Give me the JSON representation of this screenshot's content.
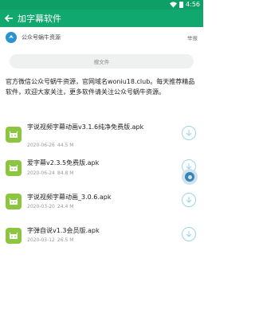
{
  "status_bar": {
    "time": "4:56"
  },
  "app_bar": {
    "title": "加字幕软件"
  },
  "account": {
    "name": "公众号蜗牛资源",
    "report": "举报"
  },
  "search": {
    "placeholder": "搜文件"
  },
  "description": "官方微信公众号蜗牛资源，官网域名woniu18.club。每天推荐精品软件，欢迎大家关注，更多软件请关注公众号蜗牛资源。",
  "files": [
    {
      "name": "字说视频字幕动画v3.1.6纯净免费版.apk",
      "date": "2020-06-26",
      "size": "44.5 M"
    },
    {
      "name": "爱字幕v2.3.5免费版.apk",
      "date": "2020-06-24",
      "size": "84.8 M"
    },
    {
      "name": "字说视频字幕动画_3.0.6.apk",
      "date": "2020-03-20",
      "size": "24.4 M"
    },
    {
      "name": "字弹自说v1.3会员版.apk",
      "date": "2020-03-12",
      "size": "26.5 M"
    }
  ],
  "colors": {
    "status_bar": "#0e9f67",
    "app_bar": "#11a870",
    "file_icon": "#8cc63f",
    "download_ring": "#9fd3ea"
  },
  "icons": {
    "back": "arrow-left",
    "avatar": "share-logo",
    "file": "android-apk",
    "download": "arrow-down-circle"
  }
}
